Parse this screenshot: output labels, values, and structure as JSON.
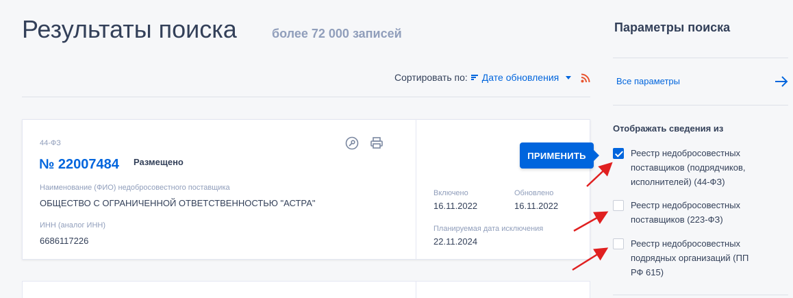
{
  "header": {
    "title": "Результаты поиска",
    "count": "более 72 000 записей"
  },
  "sort": {
    "label": "Сортировать по:",
    "value": "Дате обновления"
  },
  "record": {
    "law": "44-ФЗ",
    "number": "№ 22007484",
    "status": "Размещено",
    "supplier_label": "Наименование (ФИО) недобросовестного поставщика",
    "supplier_value": "ОБЩЕСТВО С ОГРАНИЧЕННОЙ ОТВЕТСТВЕННОСТЬЮ \"АСТРА\"",
    "inn_label": "ИНН (аналог ИНН)",
    "inn_value": "6686117226",
    "included_label": "Включено",
    "included_value": "16.11.2022",
    "updated_label": "Обновлено",
    "updated_value": "16.11.2022",
    "exclusion_label": "Планируемая дата исключения",
    "exclusion_value": "22.11.2024"
  },
  "apply_button": "ПРИМЕНИТЬ",
  "panel": {
    "title": "Параметры поиска",
    "all_params": "Все параметры",
    "section_title": "Отображать сведения из",
    "options": [
      {
        "label": "Реестр недобросовестных поставщиков (подрядчиков, исполнителей) (44-ФЗ)",
        "checked": true
      },
      {
        "label": "Реестр недобросовестных поставщиков (223-ФЗ)",
        "checked": false
      },
      {
        "label": "Реестр недобросовестных подрядных организаций (ПП РФ 615)",
        "checked": false
      }
    ]
  },
  "colors": {
    "accent": "#0065dd",
    "annotation_arrow": "#e02020",
    "rss": "#e8542f"
  }
}
